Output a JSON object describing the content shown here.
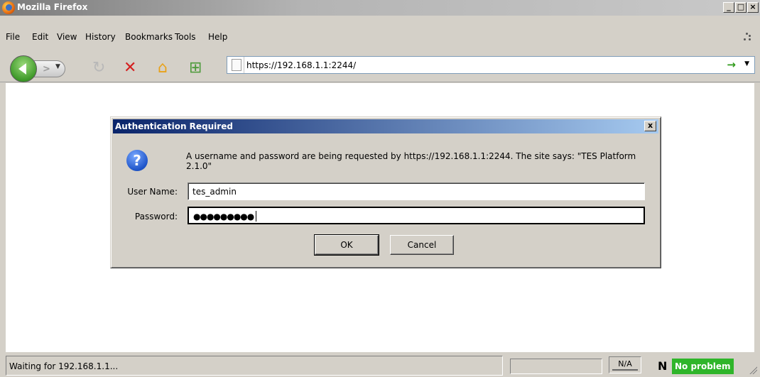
{
  "window": {
    "title": "Mozilla Firefox"
  },
  "menu": {
    "file": "File",
    "edit": "Edit",
    "view": "View",
    "history": "History",
    "bookmarks": "Bookmarks",
    "tools": "Tools",
    "help": "Help"
  },
  "toolbar": {
    "url": "https://192.168.1.1:2244/"
  },
  "dialog": {
    "title": "Authentication Required",
    "close": "x",
    "message": "A username and password are being requested by https://192.168.1.1:2244. The site says: \"TES Platform 2.1.0\"",
    "username_label": "User Name:",
    "username_value": "tes_admin",
    "password_label": "Password:",
    "password_value": "●●●●●●●●●",
    "ok_label": "OK",
    "cancel_label": "Cancel"
  },
  "status": {
    "text": "Waiting for 192.168.1.1...",
    "na": "N/A",
    "n_label": "N",
    "noproblem": "No problem"
  }
}
